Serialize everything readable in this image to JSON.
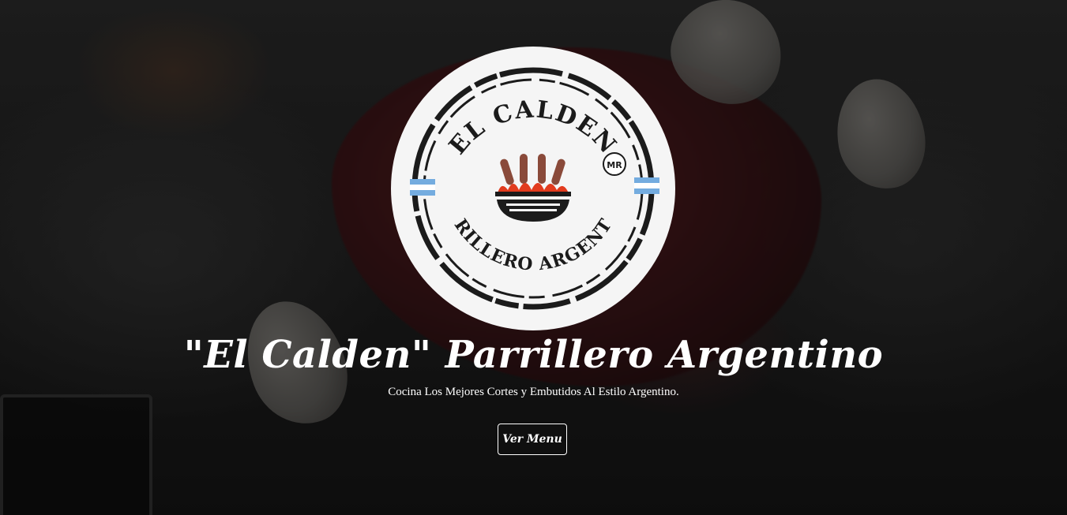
{
  "hero": {
    "logo": {
      "top_text": "EL CALDEN",
      "bottom_text": "PARRILLERO ARGENTINO",
      "badge_text": "MR"
    },
    "title": "\"El Calden\" Parrillero Argentino",
    "subtitle": "Cocina Los Mejores Cortes y Embutidos Al Estilo Argentino.",
    "cta_label": "Ver Menu"
  },
  "colors": {
    "text": "#ffffff",
    "logo_background": "#f5f5f5",
    "logo_ink": "#1b1b1b",
    "flag_blue": "#74acdf",
    "sausage": "#8a4a3a",
    "flame": "#e23b1e"
  },
  "icons": [
    "grill-icon",
    "argentina-flag-icon",
    "registered-mark-icon"
  ]
}
